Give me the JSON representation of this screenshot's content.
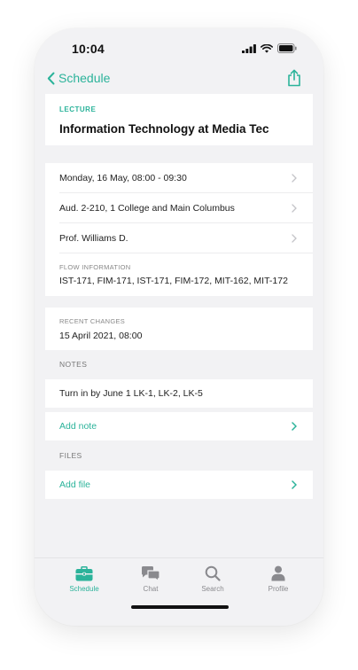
{
  "status_bar": {
    "time": "10:04"
  },
  "nav": {
    "back_label": "Schedule"
  },
  "lecture": {
    "label": "LECTURE",
    "title": "Information Technology at Media Tec"
  },
  "details": {
    "rows": [
      {
        "text": "Monday, 16 May, 08:00 - 09:30"
      },
      {
        "text": "Aud. 2-210, 1 College and Main Columbus"
      },
      {
        "text": "Prof. Williams D."
      }
    ],
    "flow_label": "FLOW INFORMATION",
    "flow_value": "IST-171, FIM-171, IST-171, FIM-172, MIT-162, MIT-172"
  },
  "recent": {
    "label": "RECENT CHANGES",
    "value": "15 April 2021, 08:00"
  },
  "notes": {
    "heading": "NOTES",
    "items": [
      {
        "text": "Turn in by June 1 LK-1, LK-2, LK-5"
      }
    ],
    "add_label": "Add note"
  },
  "files": {
    "heading": "FILES",
    "add_label": "Add file"
  },
  "tabs": [
    {
      "label": "Schedule",
      "icon": "briefcase-icon",
      "active": true
    },
    {
      "label": "Chat",
      "icon": "chat-bubbles-icon",
      "active": false
    },
    {
      "label": "Search",
      "icon": "search-icon",
      "active": false
    },
    {
      "label": "Profile",
      "icon": "person-icon",
      "active": false
    }
  ],
  "colors": {
    "accent": "#2bb39a",
    "background": "#f2f2f4",
    "card": "#ffffff",
    "inactive": "#8a8a8e"
  }
}
